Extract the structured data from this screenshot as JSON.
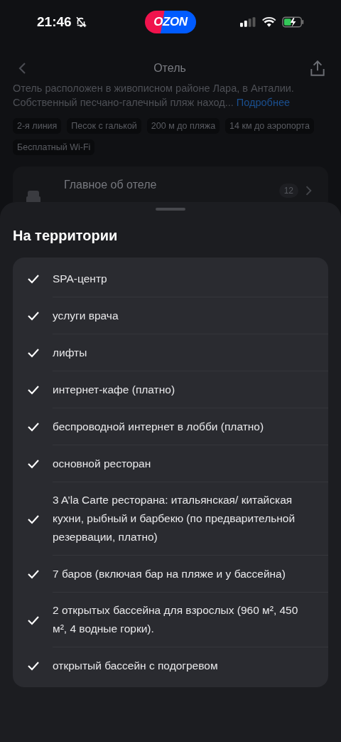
{
  "status_bar": {
    "time": "21:46",
    "muted": true,
    "logo": "OZON"
  },
  "header": {
    "title": "Отель"
  },
  "description": {
    "lines": [
      "Отель расположен в живописном районе Лара, в Анталии.",
      "Собственный песчано-галечный пляж наход..."
    ],
    "more_link": "Подробнее"
  },
  "tags": [
    "2-я линия",
    "Песок с галькой",
    "200 м до пляжа",
    "14 км до аэропорта",
    "Бесплатный Wi-Fi"
  ],
  "section_row": {
    "label": "Главное об отеле",
    "count": "12"
  },
  "sheet": {
    "title": "На территории",
    "items": [
      {
        "text": "SPA-центр",
        "checked": true
      },
      {
        "text": "услуги врача",
        "checked": true
      },
      {
        "text": "лифты",
        "checked": true
      },
      {
        "text": "интернет-кафе (платно)",
        "checked": true
      },
      {
        "text": "беспроводной интернет в лобби (платно)",
        "checked": true
      },
      {
        "text": "основной ресторан",
        "checked": true
      },
      {
        "text": "3 A’la Carte ресторана: итальянская/ китайская кухни, рыбный и барбекю (по предварительной резервации, платно)",
        "checked": true
      },
      {
        "text": "7 баров (включая бар на пляже и у бассейна)",
        "checked": true
      },
      {
        "text": "2 открытых бассейна для взрослых (960 м², 450 м², 4 водные горки).",
        "checked": true
      },
      {
        "text": "открытый бассейн с подогревом",
        "checked": true
      }
    ]
  }
}
